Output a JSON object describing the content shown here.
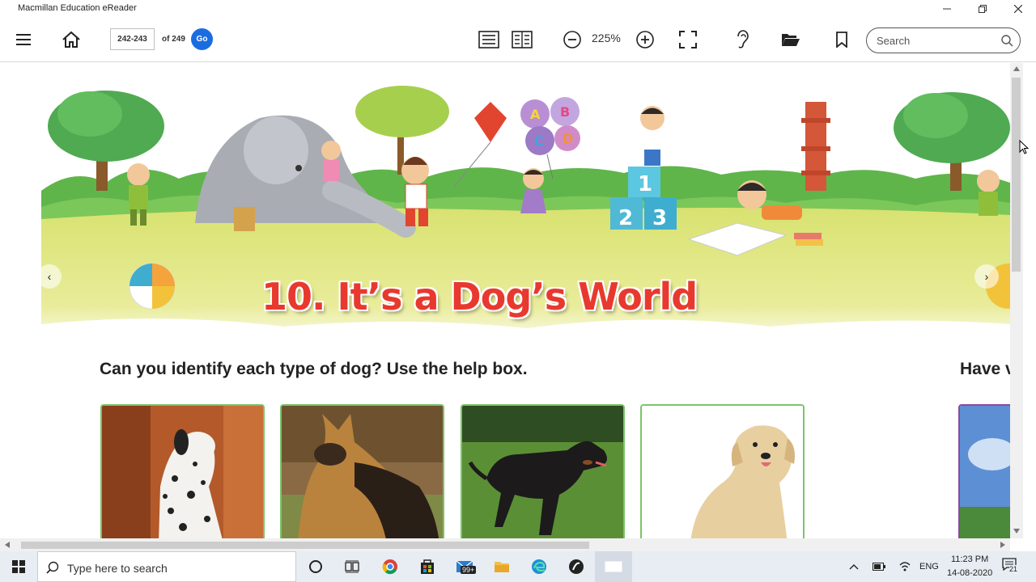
{
  "window": {
    "title": "Macmillan Education eReader"
  },
  "toolbar": {
    "page_range": "242-243",
    "page_total": "of 249",
    "go_label": "Go",
    "zoom": "225%",
    "search_placeholder": "Search"
  },
  "content": {
    "chapter_title": "10. It’s a Dog’s World",
    "question": "Can you identify each type of dog? Use the help box.",
    "question_next": "Have v",
    "banner_blocks": [
      "1",
      "2",
      "3"
    ],
    "balloons": [
      "A",
      "B",
      "C",
      "D"
    ],
    "prev_arrow": "‹",
    "next_arrow": "›"
  },
  "taskbar": {
    "search_placeholder": "Type here to search",
    "mail_badge": "99+",
    "language": "ENG",
    "time": "11:23 PM",
    "date": "14-08-2020",
    "notification_count": "21"
  },
  "colors": {
    "accent": "#1a6de0",
    "title_red": "#e8392e",
    "card_border": "#7cc36a"
  }
}
